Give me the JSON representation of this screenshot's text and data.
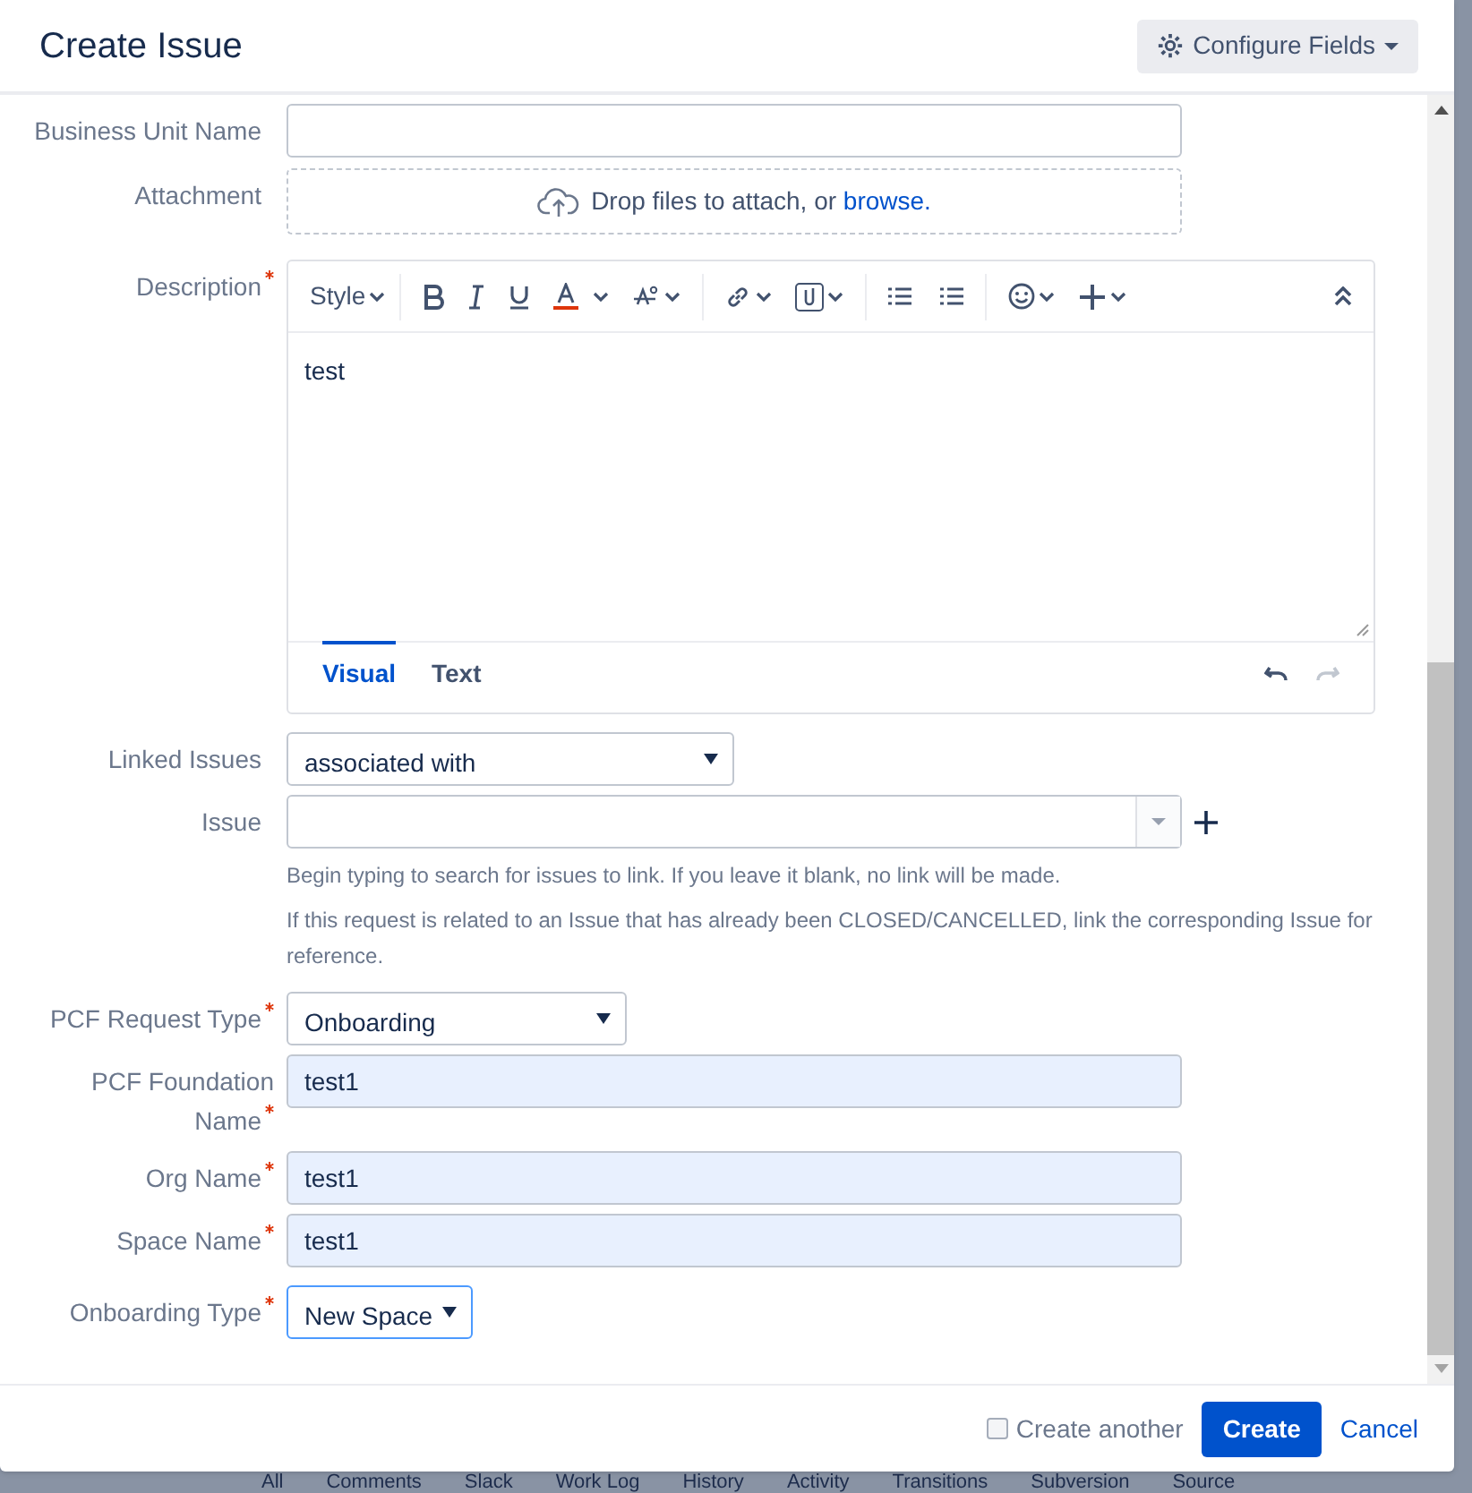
{
  "dialog": {
    "title": "Create Issue",
    "configure_button": "Configure Fields"
  },
  "fields": [
    {
      "kind": "text",
      "label": "Business Unit Name",
      "required": false
    },
    {
      "kind": "attachment",
      "label": "Attachment",
      "required": false,
      "text": "Drop files to attach, or",
      "link": "browse."
    },
    {
      "kind": "editor",
      "label": "Description",
      "required": true,
      "style_menu": "Style",
      "value": "test",
      "tabs": [
        {
          "label": "Visual",
          "selected": true
        },
        {
          "label": "Text",
          "selected": false
        }
      ]
    },
    {
      "kind": "select",
      "label": "Linked Issues",
      "required": false,
      "value": "associated with",
      "focused": false
    },
    {
      "kind": "picker",
      "label": "Issue",
      "required": false,
      "hints": [
        "Begin typing to search for issues to link. If you leave it blank, no link will be made.",
        "If this request is related to an Issue that has already been CLOSED/CANCELLED, link the corresponding Issue for reference."
      ]
    },
    {
      "kind": "select",
      "label": "PCF Request Type",
      "required": true,
      "value": "Onboarding",
      "focused": false
    },
    {
      "kind": "text",
      "label": "PCF Foundation Name",
      "required": true,
      "value": "test1"
    },
    {
      "kind": "text",
      "label": "Org Name",
      "required": true,
      "value": "test1"
    },
    {
      "kind": "text",
      "label": "Space Name",
      "required": true,
      "value": "test1"
    },
    {
      "kind": "select",
      "label": "Onboarding Type",
      "required": true,
      "value": "New Space",
      "focused": true
    }
  ],
  "footer": {
    "create_another": {
      "label": "Create another",
      "checked": false
    },
    "submit": "Create",
    "cancel": "Cancel"
  },
  "background_tabs": [
    "All",
    "Comments",
    "Slack",
    "Work Log",
    "History",
    "Activity",
    "Transitions",
    "Subversion",
    "Source"
  ]
}
